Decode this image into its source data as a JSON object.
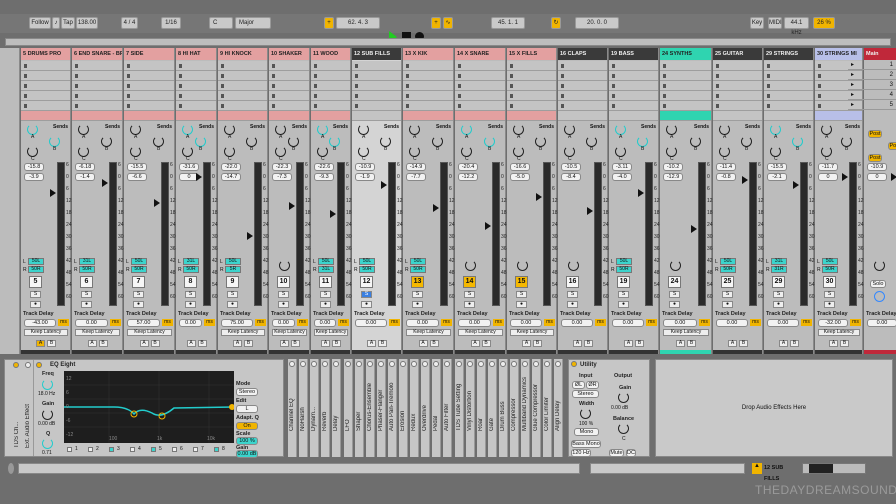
{
  "topbar": {
    "follow": "Follow",
    "tap": "Tap",
    "tempo": "138.00",
    "signature": "4 / 4",
    "quantize": "1/16",
    "key": "C",
    "scale": "Major",
    "position": "62. 4. 3",
    "loop_start": "45. 1. 1",
    "loop_length": "20. 0. 0",
    "key_btn": "Key",
    "midi_btn": "MIDI",
    "sample_rate": "44.1 kHz",
    "cpu": "26 %"
  },
  "mixer_labels": {
    "sends": "Sends",
    "track_delay": "Track Delay",
    "keep_latency": "Keep Latency",
    "ms": "ms",
    "a": "A",
    "b": "B",
    "s": "S",
    "solo": "Solo",
    "post": "Post",
    "L": "L",
    "R": "R",
    "scale": [
      "6",
      "0",
      "6",
      "12",
      "18",
      "24",
      "30",
      "36",
      "42",
      "48",
      "54",
      "60"
    ],
    "knob_a": "A",
    "knob_b": "B",
    "knob_c": "C"
  },
  "tracks": [
    {
      "name": "5 DRUMS PRO",
      "color": "#e3a0a0",
      "peak": "-15.8",
      "vol": "-3.9",
      "pan": [
        "50L",
        "50R"
      ],
      "num": "5",
      "delay": "-43.00",
      "keep": true,
      "a_on": true
    },
    {
      "name": "6 END SNARE - BR",
      "color": "#e3a0a0",
      "peak": "-6.18",
      "vol": "-1.4",
      "pan": [
        "31L",
        "50R"
      ],
      "num": "6",
      "delay": "0.00",
      "keep": true
    },
    {
      "name": "7 SIDE",
      "color": "#e3a0a0",
      "peak": "-15.5",
      "vol": "-6.6",
      "pan": [
        "50L",
        "50R"
      ],
      "num": "7",
      "delay": "57.00",
      "keep": true
    },
    {
      "name": "8 HI HAT",
      "color": "#e3a0a0",
      "peak": "-31.6",
      "vol": "0",
      "pan": [
        "31L",
        "50R"
      ],
      "num": "8",
      "delay": "0.00",
      "keep": false
    },
    {
      "name": "9 HI KNOCK",
      "color": "#e3a0a0",
      "peak": "-22.0",
      "vol": "-14.7",
      "pan": [
        "50L",
        "5R"
      ],
      "num": "9",
      "delay": "75.00",
      "keep": true
    },
    {
      "name": "10 SHAKER",
      "color": "#e3a0a0",
      "peak": "-22.3",
      "vol": "-7.3",
      "pan": null,
      "num": "10",
      "delay": "0.00",
      "keep": true
    },
    {
      "name": "11 WOOD",
      "color": "#e3a0a0",
      "peak": "-22.6",
      "vol": "-9.3",
      "pan": [
        "50L",
        "31L"
      ],
      "num": "11",
      "delay": "0.00",
      "keep": true
    },
    {
      "name": "12 SUB FILLS",
      "color": "#3a3a3a",
      "peak": "-10.9",
      "vol": "-1.9",
      "pan": [
        "50L",
        "50R"
      ],
      "num": "12",
      "delay": "0.00",
      "keep": false,
      "hl": true,
      "solo": true
    },
    {
      "name": "13 X KIK",
      "color": "#e3a0a0",
      "peak": "-14.9",
      "vol": "-7.7",
      "pan": [
        "50L",
        "50R"
      ],
      "num": "13",
      "delay": "0.00",
      "keep": true,
      "ynum": true
    },
    {
      "name": "14 X SNARE",
      "color": "#e3a0a0",
      "peak": "-20.4",
      "vol": "-12.2",
      "pan": null,
      "num": "14",
      "delay": "0.00",
      "keep": true,
      "ynum": true
    },
    {
      "name": "15 X FILLS",
      "color": "#e3a0a0",
      "peak": "-16.6",
      "vol": "-5.0",
      "pan": null,
      "num": "15",
      "delay": "0.00",
      "keep": true,
      "ynum": true
    },
    {
      "name": "16 CLAPS",
      "color": "#3a3a3a",
      "peak": "-10.5",
      "vol": "-8.4",
      "pan": null,
      "num": "16",
      "delay": "0.00",
      "keep": false
    },
    {
      "name": "19 BASS",
      "color": "#3a3a3a",
      "peak": "-3.11",
      "vol": "-4.0",
      "pan": [
        "50L",
        "50R"
      ],
      "num": "19",
      "delay": "0.00",
      "keep": false
    },
    {
      "name": "24 SYNTHS",
      "color": "#2fd4b0",
      "peak": "-10.2",
      "vol": "-12.9",
      "pan": null,
      "num": "24",
      "delay": "0.00",
      "keep": true
    },
    {
      "name": "25 GUITAR",
      "color": "#3a3a3a",
      "peak": "-11.4",
      "vol": "-0.8",
      "pan": [
        "50L",
        "50R"
      ],
      "num": "25",
      "delay": "0.00",
      "keep": false
    },
    {
      "name": "29 STRINGS",
      "color": "#3a3a3a",
      "peak": "-15.5",
      "vol": "-2.1",
      "pan": [
        "31L",
        "31R"
      ],
      "num": "29",
      "delay": "0.00",
      "keep": false
    },
    {
      "name": "30 STRINGS MI",
      "color": "#b8bfe8",
      "peak": "-11.7",
      "vol": "0",
      "pan": [
        "50L",
        "50R"
      ],
      "num": "30",
      "delay": "-32.00",
      "keep": true
    },
    {
      "name": "Main",
      "color": "#c0283a",
      "peak": "-10.9",
      "vol": "0",
      "pan": null,
      "num": "",
      "delay": "0.00",
      "keep": false,
      "main": true
    }
  ],
  "scenes": [
    "1",
    "2",
    "3",
    "4",
    "5"
  ],
  "devices": {
    "left": [
      "TDS Ch...",
      "Ext. Audio Effect"
    ],
    "eq": {
      "title": "EQ Eight",
      "freq": "Freq",
      "freq_val": "18.0 Hz",
      "gain": "Gain",
      "gain_val": "0.00 dB",
      "q": "Q",
      "q_val": "0.71",
      "axis_y": [
        "12",
        "6",
        "0",
        "-6",
        "-12"
      ],
      "axis_x": [
        "100",
        "1k",
        "10k"
      ],
      "bands": [
        "1",
        "2",
        "3",
        "4",
        "5",
        "6",
        "7",
        "8"
      ],
      "mode": "Mode",
      "mode_val": "Stereo",
      "edit": "Edit",
      "edit_val": "L",
      "adapt": "Adapt. Q",
      "adapt_val": "On",
      "scale": "Scale",
      "scale_val": "100 %",
      "out_gain": "Gain",
      "out_gain_val": "0.00 dB"
    },
    "plugins": [
      "Channel EQ",
      "NoHarsh",
      "Dynam...",
      "Reverb",
      "Delay",
      "LFO",
      "Shaper",
      "Chorus-Ensemble",
      "Phaser-Flanger",
      "Auto Pan-Tremolo",
      "Erosion",
      "Redux",
      "Overdrive",
      "Pedal",
      "Auto Filter",
      "TDS Tube Setting",
      "Vinyl Distortion",
      "Roar",
      "Gate",
      "Drum Buss",
      "Compressor",
      "Multiband Dynamics",
      "Glue Compressor",
      "Color Limiter",
      "Align Delay"
    ],
    "utility": {
      "title": "Utility",
      "input": "Input",
      "output": "Output",
      "left_ch": "ØL",
      "right_ch": "ØR",
      "channel": "Stereo",
      "width": "Width",
      "width_val": "100 %",
      "mono": "Mono",
      "bass_mono": "Bass Mono",
      "bass_freq": "120 Hz",
      "gain": "Gain",
      "gain_val": "0.00 dB",
      "balance": "Balance",
      "balance_val": "C",
      "mute": "Mute",
      "dc": "DC"
    },
    "drop": "Drop Audio Effects Here"
  },
  "status": {
    "track": "12 SUB FILLS"
  },
  "watermark": "THEDAYDREAMSOUND"
}
